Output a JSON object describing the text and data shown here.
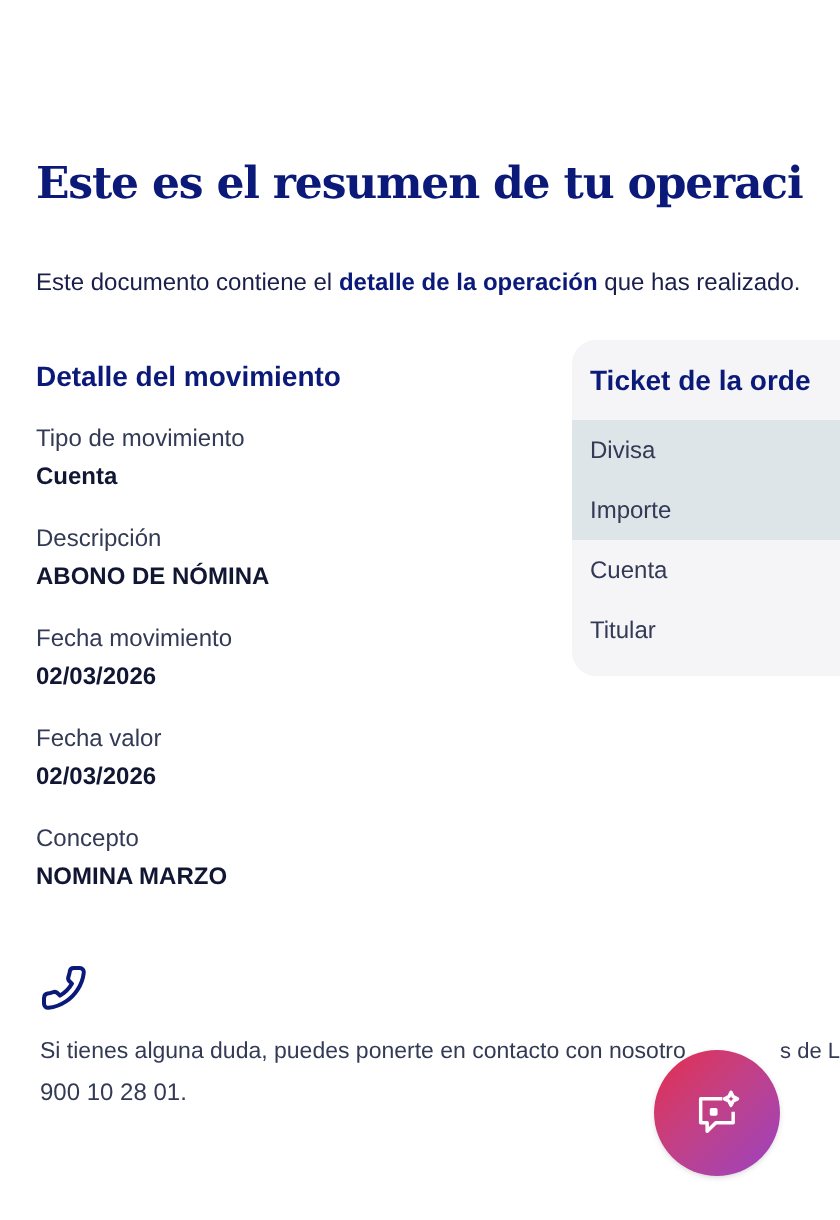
{
  "title": "Este es el resumen de tu operaci",
  "intro": "Este documento contiene el **detalle de la operación** que has realizado.",
  "detail": {
    "heading": "Detalle del movimiento",
    "fields": [
      {
        "label": "Tipo de movimiento",
        "value": "Cuenta"
      },
      {
        "label": "Descripción",
        "value": "ABONO DE NÓMINA"
      },
      {
        "label": "Fecha movimiento",
        "value": "02/03/2026"
      },
      {
        "label": "Fecha valor",
        "value": "02/03/2026"
      },
      {
        "label": "Concepto",
        "value": "NOMINA MARZO"
      }
    ]
  },
  "ticket": {
    "heading": "Ticket de la orde",
    "rows": [
      {
        "label": "Divisa",
        "highlighted": true
      },
      {
        "label": "Importe",
        "highlighted": true
      },
      {
        "label": "Cuenta",
        "highlighted": false
      },
      {
        "label": "Titular",
        "highlighted": false
      }
    ]
  },
  "contact": {
    "line_start": "Si tienes alguna duda, puedes ponerte en contacto con nosotro",
    "line_end": "s de L",
    "phone": "900 10 28 01."
  }
}
